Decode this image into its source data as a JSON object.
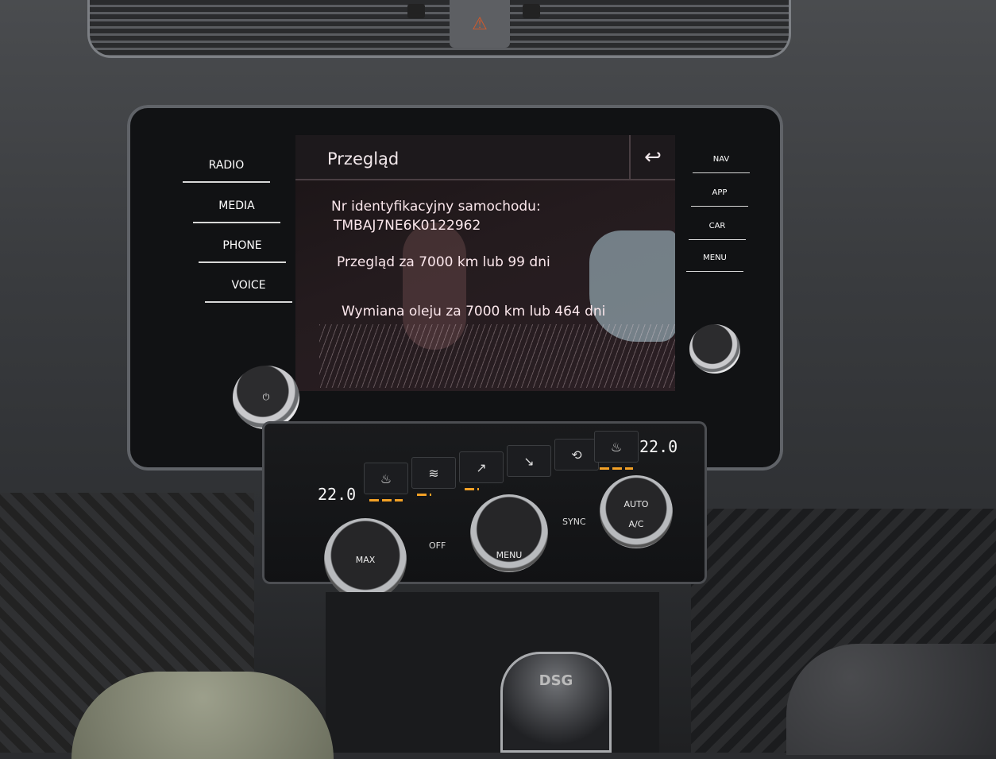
{
  "screen": {
    "title": "Przegląd",
    "back_icon": "back-arrow-icon",
    "lines": [
      "Nr identyfikacyjny samochodu:",
      "TMBAJ7NE6K0122962",
      "Przegląd za 7000 km lub 99 dni",
      "Wymiana oleju za 7000 km lub 464 dni"
    ]
  },
  "left_buttons": [
    "RADIO",
    "MEDIA",
    "PHONE",
    "VOICE"
  ],
  "right_buttons": [
    "NAV",
    "APP",
    "CAR",
    "MENU"
  ],
  "climate": {
    "temp_left": "22.0",
    "temp_right": "22.0",
    "labels": {
      "off": "OFF",
      "sync": "SYNC",
      "auto": "AUTO",
      "ac": "A/C",
      "menu": "MENU",
      "max": "MAX"
    }
  },
  "gear_label": "DSG",
  "colors": {
    "indicator": "#f3a126",
    "hazard": "#d45a2a"
  }
}
